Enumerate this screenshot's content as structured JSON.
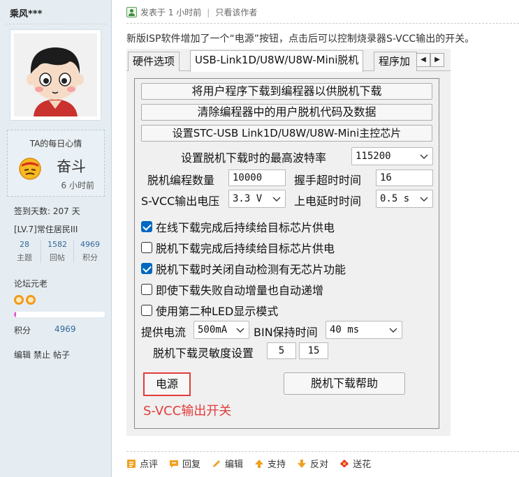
{
  "sidebar": {
    "username": "乘风***",
    "mood": {
      "title": "TA的每日心情",
      "text": "奋斗",
      "time": "6 小时前"
    },
    "sign_days": "签到天数: 207 天",
    "level": "[LV.7]常住居民III",
    "stats": [
      {
        "value": "28",
        "label": "主题"
      },
      {
        "value": "1582",
        "label": "回帖"
      },
      {
        "value": "4969",
        "label": "积分"
      }
    ],
    "rank": "论坛元老",
    "progress_fraction": 0.02,
    "points_label": "积分",
    "points_value": "4969",
    "admin": {
      "edit": "编辑",
      "ban": "禁止",
      "posts": "帖子"
    }
  },
  "post": {
    "posted": "发表于 1 小时前",
    "only_author": "只看该作者",
    "description": "新版ISP软件增加了一个“电源”按钮，点击后可以控制烧录器S-VCC输出的开关。"
  },
  "window": {
    "tabs": [
      "硬件选项",
      "USB-Link1D/U8W/U8W-Mini脱机",
      "程序加"
    ],
    "buttons": {
      "download_to_programmer": "将用户程序下载到编程器以供脱机下载",
      "clear_offline": "清除编程器中的用户脱机代码及数据",
      "set_master_chip": "设置STC-USB Link1D/U8W/U8W-Mini主控芯片"
    },
    "fields": {
      "max_baud_label": "设置脱机下载时的最高波特率",
      "max_baud_value": "115200",
      "prog_count_label": "脱机编程数量",
      "prog_count_value": "10000",
      "handshake_label": "握手超时时间",
      "handshake_value": "16",
      "svcc_label": "S-VCC输出电压",
      "svcc_value": "3.3 V",
      "power_delay_label": "上电延时时间",
      "power_delay_value": "0.5 s",
      "supply_current_label": "提供电流",
      "supply_current_value": "500mA",
      "bin_hold_label": "BIN保持时间",
      "bin_hold_value": "40 ms",
      "sensitivity_label": "脱机下载灵敏度设置",
      "sensitivity_1": "5",
      "sensitivity_2": "15"
    },
    "checkboxes": [
      {
        "label": "在线下载完成后持续给目标芯片供电",
        "checked": true
      },
      {
        "label": "脱机下载完成后持续给目标芯片供电",
        "checked": false
      },
      {
        "label": "脱机下载时关闭自动检测有无芯片功能",
        "checked": true
      },
      {
        "label": "即使下载失败自动增量也自动递增",
        "checked": false
      },
      {
        "label": "使用第二种LED显示模式",
        "checked": false
      }
    ],
    "power_button": "电源",
    "help_button": "脱机下载帮助",
    "annotation": "S-VCC输出开关",
    "annotation_color": "#e23b3b"
  },
  "actions": [
    {
      "label": "点评",
      "icon": "comment-icon"
    },
    {
      "label": "回复",
      "icon": "reply-icon"
    },
    {
      "label": "编辑",
      "icon": "edit-icon"
    },
    {
      "label": "支持",
      "icon": "thumb-up-icon"
    },
    {
      "label": "反对",
      "icon": "thumb-down-icon"
    },
    {
      "label": "送花",
      "icon": "flower-icon"
    }
  ]
}
